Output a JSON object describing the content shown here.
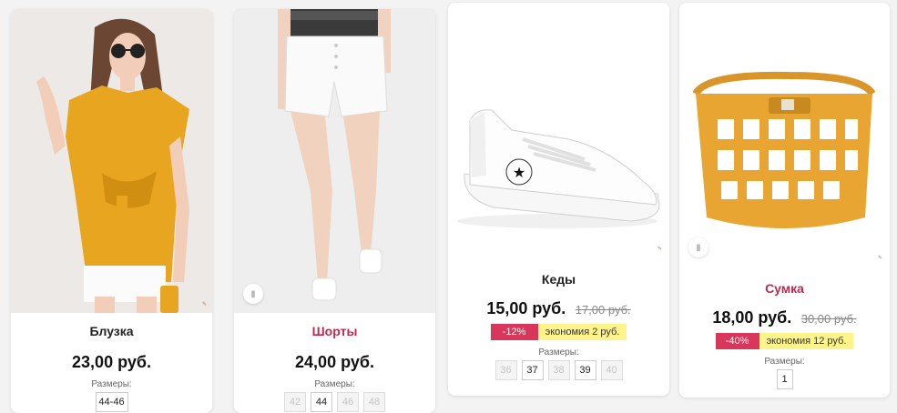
{
  "products": [
    {
      "name": "Блузка",
      "price": "23,00 руб.",
      "sizes_label": "Размеры:",
      "sizes": [
        {
          "label": "44-46",
          "available": true
        }
      ]
    },
    {
      "name": "Шорты",
      "price": "24,00 руб.",
      "sizes_label": "Размеры:",
      "sizes": [
        {
          "label": "42",
          "available": false
        },
        {
          "label": "44",
          "available": true
        },
        {
          "label": "46",
          "available": false
        },
        {
          "label": "48",
          "available": false
        }
      ]
    },
    {
      "name": "Кеды",
      "price": "15,00 руб.",
      "old_price": "17,00 руб.",
      "discount": "-12%",
      "savings": "экономия 2 руб.",
      "sizes_label": "Размеры:",
      "sizes": [
        {
          "label": "36",
          "available": false
        },
        {
          "label": "37",
          "available": true
        },
        {
          "label": "38",
          "available": false
        },
        {
          "label": "39",
          "available": true
        },
        {
          "label": "40",
          "available": false
        }
      ]
    },
    {
      "name": "Сумка",
      "price": "18,00 руб.",
      "old_price": "30,00 руб.",
      "discount": "-40%",
      "savings": "экономия 12 руб.",
      "sizes_label": "Размеры:",
      "sizes": [
        {
          "label": "1",
          "available": true
        }
      ]
    }
  ],
  "colors": {
    "accent": "#c0294f",
    "discount_badge": "#d8365b",
    "savings_badge": "#fff48a",
    "product_yellow": "#e7a92a"
  },
  "icons": {
    "bookmark": "bookmark-icon"
  }
}
